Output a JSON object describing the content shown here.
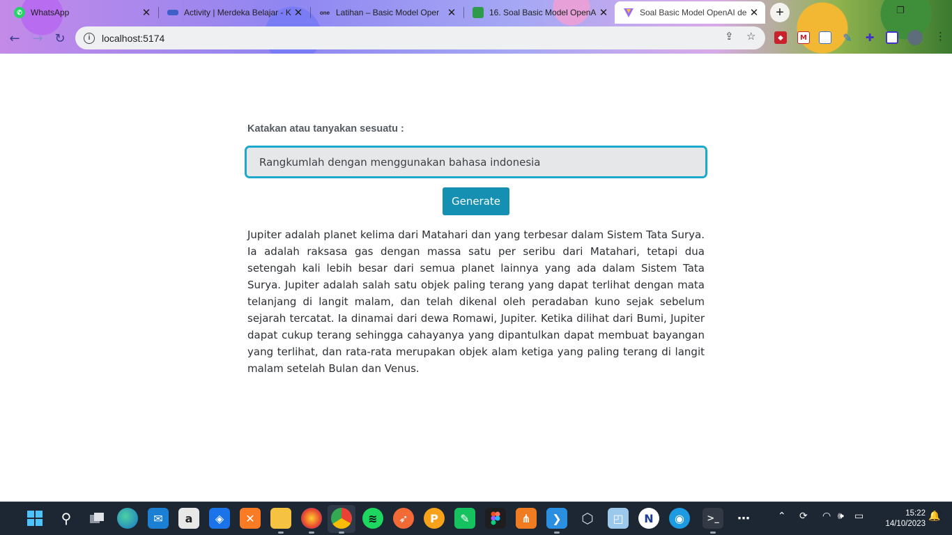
{
  "browser": {
    "tabs": [
      {
        "title": "WhatsApp",
        "icon": "whatsapp-icon",
        "active": false
      },
      {
        "title": "Activity | Merdeka Belajar - K",
        "icon": "merdeka-icon",
        "active": false
      },
      {
        "title": "Latihan – Basic Model Oper",
        "icon": "one-icon",
        "active": false
      },
      {
        "title": "16. Soal Basic Model OpenA",
        "icon": "book-icon",
        "active": false
      },
      {
        "title": "Soal Basic Model OpenAI de",
        "icon": "vite-icon",
        "active": true
      }
    ],
    "new_tab_label": "+",
    "url": "localhost:5174",
    "tab_close_glyph": "✕"
  },
  "page": {
    "prompt_label": "Katakan atau tanyakan sesuatu :",
    "prompt_value": "Rangkumlah dengan menggunakan bahasa indonesia",
    "generate_label": "Generate",
    "result_text": "Jupiter adalah planet kelima dari Matahari dan yang terbesar dalam Sistem Tata Surya. Ia adalah raksasa gas dengan massa satu per seribu dari Matahari, tetapi dua setengah kali lebih besar dari semua planet lainnya yang ada dalam Sistem Tata Surya. Jupiter adalah salah satu objek paling terang yang dapat terlihat dengan mata telanjang di langit malam, dan telah dikenal oleh peradaban kuno sejak sebelum sejarah tercatat. Ia dinamai dari dewa Romawi, Jupiter. Ketika dilihat dari Bumi, Jupiter dapat cukup terang sehingga cahayanya yang dipantulkan dapat membuat bayangan yang terlihat, dan rata-rata merupakan objek alam ketiga yang paling terang di langit malam setelah Bulan dan Venus."
  },
  "taskbar": {
    "time": "15:22",
    "date": "14/10/2023"
  },
  "colors": {
    "accent": "#1590b3",
    "input_border": "#1ea8cc",
    "taskbar": "#1d2633"
  }
}
